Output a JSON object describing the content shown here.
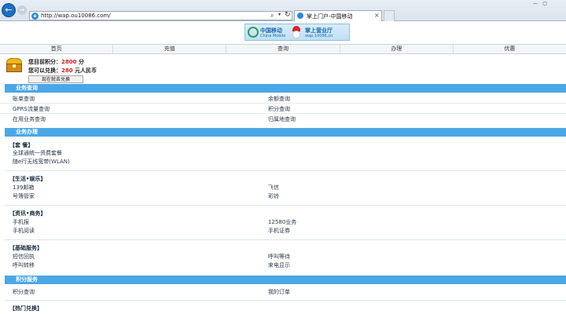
{
  "browser": {
    "url": "http://wap.ou10086.com/",
    "tab_title": "掌上门户-中国移动",
    "back_icon": "←",
    "forward_icon": "→",
    "search_icon": "⌕",
    "dropdown_icon": "▾",
    "refresh_icon": "↻",
    "close_icon": "×",
    "win_min": "—",
    "win_max": "▢"
  },
  "banner": {
    "cm_cn": "中国移动",
    "cm_en": "China Mobile",
    "hall_cn": "掌上营业厅",
    "hall_url": "wap.10086.cn"
  },
  "nav": [
    "首页",
    "充值",
    "查询",
    "办理",
    "优惠"
  ],
  "points": {
    "line1_label": "您目前积分：",
    "line1_value": "2800",
    "line1_unit": " 分",
    "line2_label": "您可以兑换：",
    "line2_value": "280",
    "line2_unit": " 元人民币",
    "redeem_button": "现在就去兑换"
  },
  "query_section": {
    "title": "业务查询",
    "rows": [
      [
        "账单查询",
        "余额查询"
      ],
      [
        "GPRS流量查询",
        "积分查询"
      ],
      [
        "在用业务查询",
        "归属地查询"
      ]
    ]
  },
  "handle_section": {
    "title": "业务办理",
    "groups": [
      {
        "title": "【套 餐】",
        "rows": [
          [
            "全球通统一资费套餐",
            ""
          ],
          [
            "随e行无线宽带(WLAN)",
            ""
          ]
        ]
      },
      {
        "title": "【生活•娱乐】",
        "rows": [
          [
            "139邮箱",
            "飞信"
          ],
          [
            "号簿管家",
            "彩铃"
          ]
        ]
      },
      {
        "title": "【资讯•商务】",
        "rows": [
          [
            "手机报",
            "12580业务"
          ],
          [
            "手机阅读",
            "手机证券"
          ]
        ]
      },
      {
        "title": "【基础服务】",
        "rows": [
          [
            "短信回执",
            "呼叫等待"
          ],
          [
            "呼叫转移",
            "来电显示"
          ]
        ]
      }
    ]
  },
  "points_section": {
    "title": "积分服务",
    "rows": [
      [
        "积分查询",
        "我的订单"
      ]
    ]
  },
  "hot_section": {
    "title": "【热门兑换】"
  }
}
